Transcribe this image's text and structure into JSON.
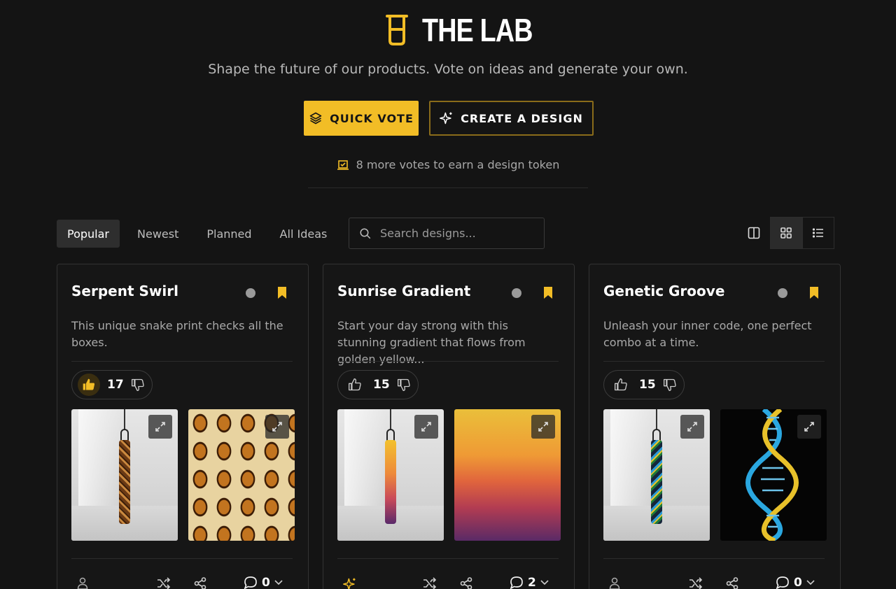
{
  "app": {
    "title": "THE LAB",
    "subtitle": "Shape the future of our products. Vote on ideas and generate your own.",
    "quick_vote_label": "QUICK VOTE",
    "create_design_label": "CREATE A DESIGN",
    "token_note": "8 more votes to earn a design token",
    "accent_color": "#f2bd26"
  },
  "tabs": [
    {
      "label": "Popular",
      "active": true
    },
    {
      "label": "Newest",
      "active": false
    },
    {
      "label": "Planned",
      "active": false
    },
    {
      "label": "All Ideas",
      "active": false
    }
  ],
  "search": {
    "placeholder": "Search designs..."
  },
  "view_toggles": [
    "split-view-icon",
    "grid-view-icon",
    "list-view-icon"
  ],
  "active_view": "grid",
  "cards": [
    {
      "title": "Serpent Swirl",
      "description": "This unique snake print checks all the boxes.",
      "votes": "17",
      "upvoted": true,
      "comments": "0",
      "creator_icon": "user-icon",
      "preview": "snake-print"
    },
    {
      "title": "Sunrise Gradient",
      "description": "Start your day strong with this stunning gradient that flows from golden yellow...",
      "votes": "15",
      "upvoted": false,
      "comments": "2",
      "creator_icon": "sparkle-icon",
      "preview": "sunrise-gradient"
    },
    {
      "title": "Genetic Groove",
      "description": "Unleash your inner code, one perfect combo at a time.",
      "votes": "15",
      "upvoted": false,
      "comments": "0",
      "creator_icon": "user-icon",
      "preview": "dna-helix"
    }
  ]
}
